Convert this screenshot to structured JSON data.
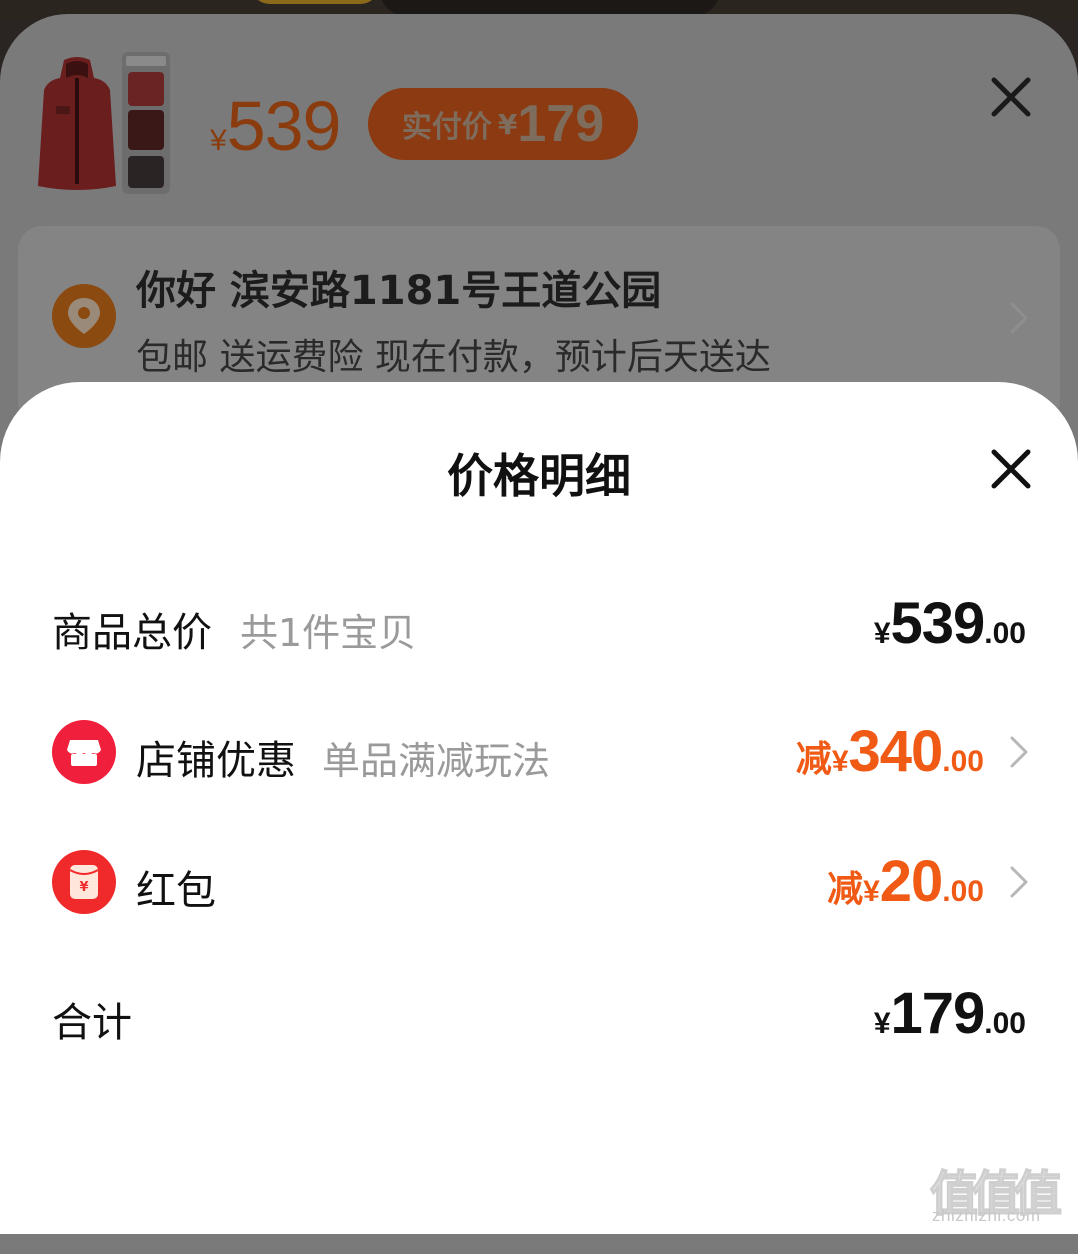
{
  "product": {
    "price_symbol": "¥",
    "price": "539",
    "pay_label": "实付价",
    "pay_symbol": "¥",
    "pay_price": "179"
  },
  "address": {
    "line1": "你好 滨安路1181号王道公园",
    "line2": "包邮 送运费险 现在付款，预计后天送达"
  },
  "sheet": {
    "title": "价格明细"
  },
  "rows": [
    {
      "label": "商品总价",
      "sub": "共1件宝贝",
      "yen": "¥",
      "int": "539",
      "dec": ".00"
    },
    {
      "label": "店铺优惠",
      "sub": "单品满减玩法",
      "minus": "减",
      "yen": "¥",
      "int": "340",
      "dec": ".00",
      "icon": "shop-icon"
    },
    {
      "label": "红包",
      "minus": "减",
      "yen": "¥",
      "int": "20",
      "dec": ".00",
      "icon": "red-envelope-icon"
    },
    {
      "label": "合计",
      "yen": "¥",
      "int": "179",
      "dec": ".00"
    }
  ],
  "watermark": {
    "glyphs": "值值值",
    "domain": "zhizhizhi.com"
  },
  "colors": {
    "accent_orange": "#f05a14",
    "shop_icon_red": "#f0203c",
    "red_envelope": "#f02a2a",
    "location_pin": "#8a4a10"
  }
}
